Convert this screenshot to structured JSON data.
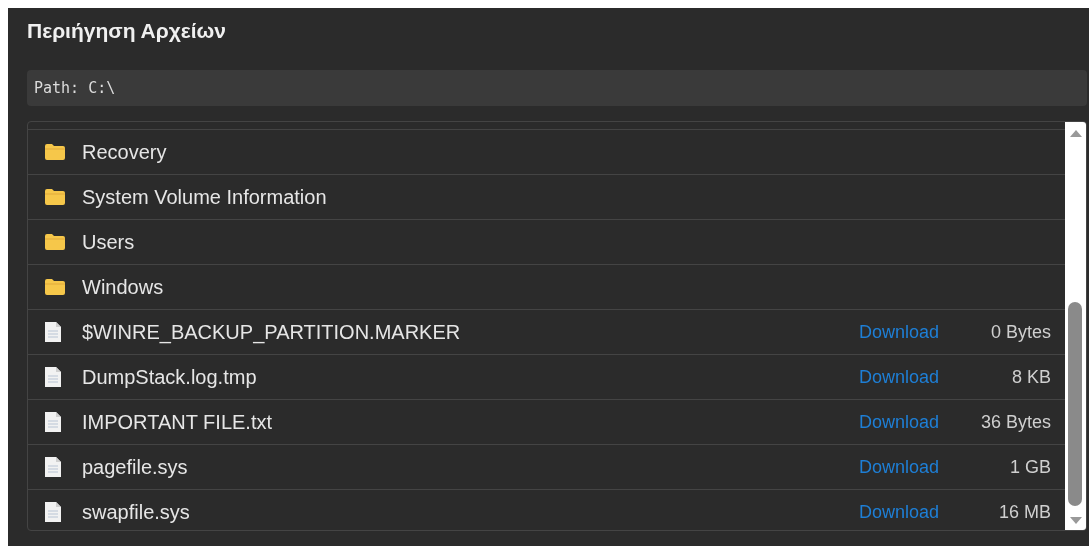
{
  "title": "Περιήγηση Αρχείων",
  "path": "Path: C:\\",
  "items": [
    {
      "kind": "folder",
      "name": "Recovery"
    },
    {
      "kind": "folder",
      "name": "System Volume Information"
    },
    {
      "kind": "folder",
      "name": "Users"
    },
    {
      "kind": "folder",
      "name": "Windows"
    },
    {
      "kind": "file",
      "name": "$WINRE_BACKUP_PARTITION.MARKER",
      "action": "Download",
      "size": "0 Bytes"
    },
    {
      "kind": "file",
      "name": "DumpStack.log.tmp",
      "action": "Download",
      "size": "8 KB"
    },
    {
      "kind": "file",
      "name": "IMPORTANT FILE.txt",
      "action": "Download",
      "size": "36 Bytes"
    },
    {
      "kind": "file",
      "name": "pagefile.sys",
      "action": "Download",
      "size": "1 GB"
    },
    {
      "kind": "file",
      "name": "swapfile.sys",
      "action": "Download",
      "size": "16 MB"
    }
  ]
}
